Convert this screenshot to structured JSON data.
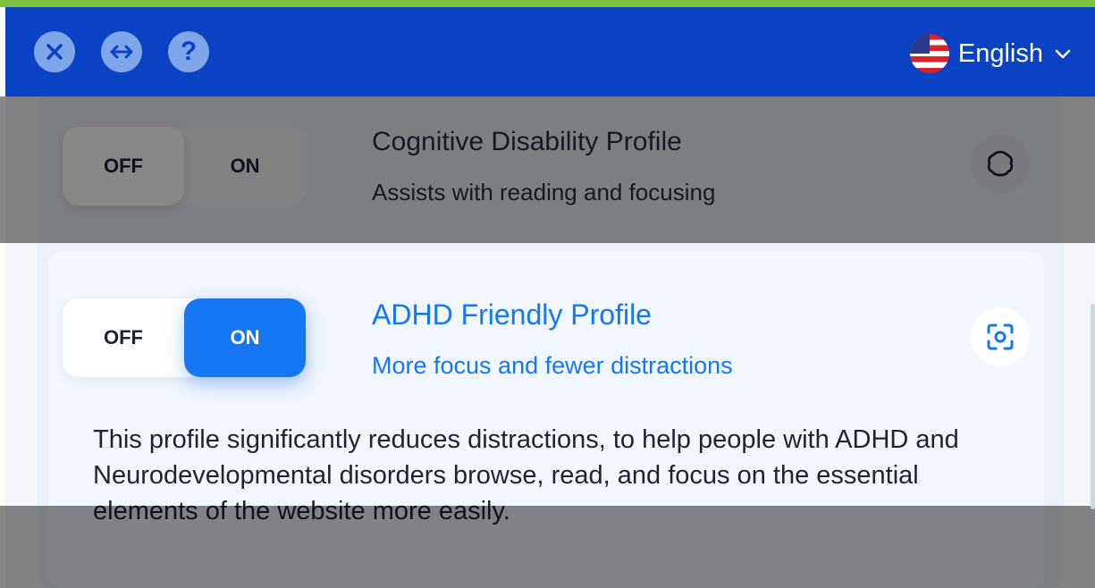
{
  "header": {
    "close_icon": "close-circle-icon",
    "resize_icon": "arrows-horizontal-icon",
    "help_icon": "help-icon",
    "help_glyph": "?",
    "language": {
      "label": "English",
      "flag": "us-flag-icon",
      "chevron": "chevron-down-icon"
    }
  },
  "profiles": [
    {
      "title": "Cognitive Disability Profile",
      "subtitle": "Assists with reading and focusing",
      "toggle": {
        "off_label": "OFF",
        "on_label": "ON",
        "state": "off"
      },
      "icon": "brain-outline-icon"
    },
    {
      "title": "ADHD Friendly Profile",
      "subtitle": "More focus and fewer distractions",
      "toggle": {
        "off_label": "OFF",
        "on_label": "ON",
        "state": "on"
      },
      "icon": "focus-target-icon",
      "description": "This profile significantly reduces distractions, to help people with ADHD and Neurodevelopmental disorders browse, read, and focus on the essential elements of the website more easily."
    }
  ],
  "colors": {
    "header_bg": "#0a42c4",
    "accent": "#1677f5",
    "active_card_bg": "#f1f6ff"
  }
}
